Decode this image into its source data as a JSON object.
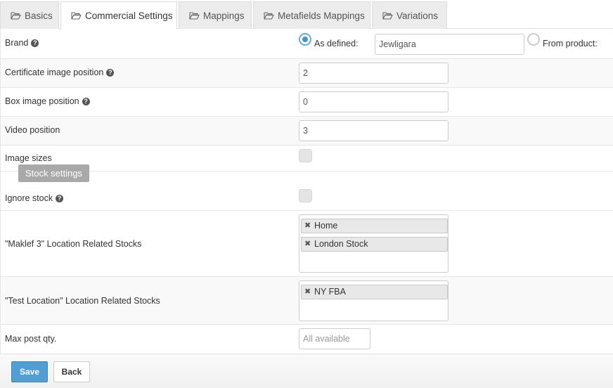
{
  "tabs": [
    {
      "label": "Basics",
      "active": false
    },
    {
      "label": "Commercial Settings",
      "active": true
    },
    {
      "label": "Mappings",
      "active": false
    },
    {
      "label": "Metafields Mappings",
      "active": false
    },
    {
      "label": "Variations",
      "active": false
    }
  ],
  "brand": {
    "label": "Brand",
    "option_defined": "As defined:",
    "defined_value": "Jewligara",
    "option_product": "From product:",
    "selected": "As defined:"
  },
  "certificate_position": {
    "label": "Certificate image position",
    "value": "2"
  },
  "box_position": {
    "label": "Box image position",
    "value": "0"
  },
  "video_position": {
    "label": "Video position",
    "value": "3"
  },
  "image_sizes": {
    "label": "Image sizes",
    "checked": false
  },
  "stock_settings": {
    "label": "Stock settings"
  },
  "ignore_stock": {
    "label": "Ignore stock",
    "checked": false
  },
  "maklef_stocks": {
    "label": "\"Maklef 3\" Location Related Stocks",
    "tags": [
      "Home",
      "London Stock"
    ]
  },
  "test_location_stocks": {
    "label": "\"Test Location\" Location Related Stocks",
    "tags": [
      "NY FBA"
    ]
  },
  "max_post_qty": {
    "label": "Max post qty.",
    "placeholder": "All available"
  },
  "footer": {
    "save_label": "Save",
    "back_label": "Back"
  },
  "icons": {
    "tab": "folder-open-icon",
    "help": "question-circle-icon",
    "remove": "times-icon"
  },
  "colors": {
    "primary": "#4f9ed4",
    "radio": "#4a93c7",
    "badge": "#a9a9a9"
  }
}
